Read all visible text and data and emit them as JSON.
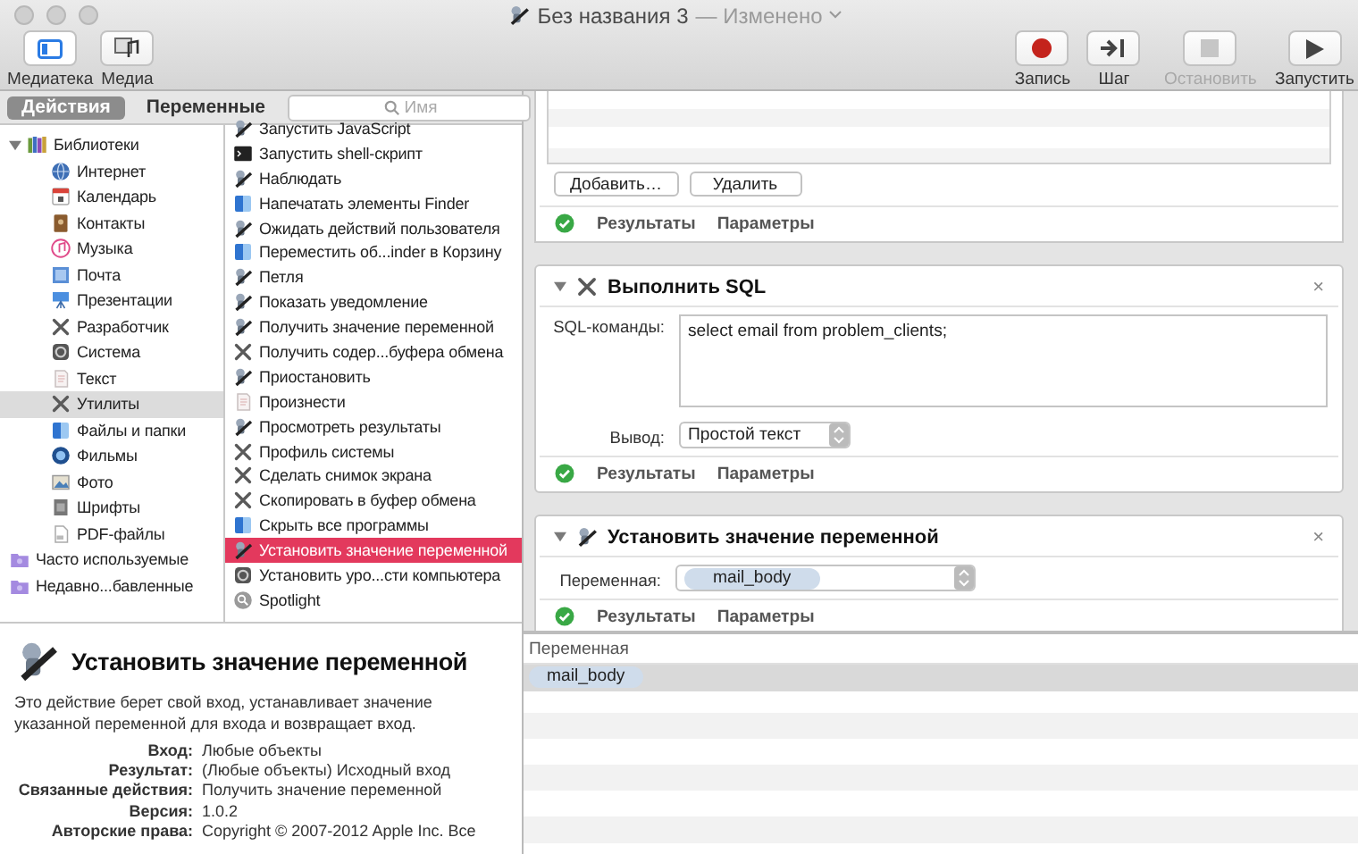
{
  "window": {
    "title": "Без названия 3",
    "subtitle": "— Изменено"
  },
  "toolbar_left": [
    {
      "label": "Медиатека",
      "kind": "library",
      "selected": true
    },
    {
      "label": "Медиа",
      "kind": "media",
      "selected": false
    }
  ],
  "toolbar_right": [
    {
      "label": "Запись",
      "kind": "record",
      "disabled": false
    },
    {
      "label": "Шаг",
      "kind": "step",
      "disabled": false
    },
    {
      "label": "Остановить",
      "kind": "stop",
      "disabled": true
    },
    {
      "label": "Запустить",
      "kind": "run",
      "disabled": false
    }
  ],
  "tabs": [
    {
      "label": "Действия",
      "selected": true
    },
    {
      "label": "Переменные",
      "selected": false
    }
  ],
  "search": {
    "placeholder": "Имя"
  },
  "library": [
    {
      "label": "Библиотеки",
      "kind": "books",
      "selected": false,
      "expanded": true,
      "children": [
        {
          "label": "Интернет",
          "kind": "globe",
          "selected": false
        },
        {
          "label": "Календарь",
          "kind": "calendar",
          "selected": false
        },
        {
          "label": "Контакты",
          "kind": "contacts",
          "selected": false
        },
        {
          "label": "Музыка",
          "kind": "music",
          "selected": false
        },
        {
          "label": "Почта",
          "kind": "mail",
          "selected": false
        },
        {
          "label": "Презентации",
          "kind": "presentation",
          "selected": false
        },
        {
          "label": "Разработчик",
          "kind": "tools",
          "selected": false
        },
        {
          "label": "Система",
          "kind": "system",
          "selected": false
        },
        {
          "label": "Текст",
          "kind": "text",
          "selected": false
        },
        {
          "label": "Утилиты",
          "kind": "tools",
          "selected": true
        },
        {
          "label": "Файлы и папки",
          "kind": "finder",
          "selected": false
        },
        {
          "label": "Фильмы",
          "kind": "movies",
          "selected": false
        },
        {
          "label": "Фото",
          "kind": "photo",
          "selected": false
        },
        {
          "label": "Шрифты",
          "kind": "fonts",
          "selected": false
        },
        {
          "label": "PDF-файлы",
          "kind": "pdf",
          "selected": false
        }
      ]
    },
    {
      "label": "Часто используемые",
      "kind": "folder",
      "selected": false
    },
    {
      "label": "Недавно...бавленные",
      "kind": "folder",
      "selected": false
    }
  ],
  "actions": [
    {
      "label": "Запустить JavaScript",
      "kind": "robot",
      "selected": false
    },
    {
      "label": "Запустить shell-скрипт",
      "kind": "terminal",
      "selected": false
    },
    {
      "label": "Наблюдать",
      "kind": "robot",
      "selected": false
    },
    {
      "label": "Напечатать элементы Finder",
      "kind": "finder",
      "selected": false
    },
    {
      "label": "Ожидать действий пользователя",
      "kind": "robot",
      "selected": false
    },
    {
      "label": "Переместить об...inder в Корзину",
      "kind": "finder",
      "selected": false
    },
    {
      "label": "Петля",
      "kind": "robot",
      "selected": false
    },
    {
      "label": "Показать уведомление",
      "kind": "robot",
      "selected": false
    },
    {
      "label": "Получить значение переменной",
      "kind": "robot",
      "selected": false
    },
    {
      "label": "Получить содер...буфера обмена",
      "kind": "tools",
      "selected": false
    },
    {
      "label": "Приостановить",
      "kind": "robot",
      "selected": false
    },
    {
      "label": "Произнести",
      "kind": "text",
      "selected": false
    },
    {
      "label": "Просмотреть результаты",
      "kind": "robot",
      "selected": false
    },
    {
      "label": "Профиль системы",
      "kind": "tools",
      "selected": false
    },
    {
      "label": "Сделать снимок экрана",
      "kind": "tools",
      "selected": false
    },
    {
      "label": "Скопировать в буфер обмена",
      "kind": "tools",
      "selected": false
    },
    {
      "label": "Скрыть все программы",
      "kind": "finder",
      "selected": false
    },
    {
      "label": "Установить значение переменной",
      "kind": "robot",
      "selected": true
    },
    {
      "label": "Установить уро...сти компьютера",
      "kind": "system",
      "selected": false
    },
    {
      "label": "Spotlight",
      "kind": "spotlight",
      "selected": false
    }
  ],
  "description": {
    "title": "Установить значение переменной",
    "text": "Это действие берет свой вход, устанавливает значение указанной переменной для входа и возвращает вход.",
    "details": [
      {
        "label": "Вход:",
        "value": "Любые объекты"
      },
      {
        "label": "Результат:",
        "value": "(Любые объекты) Исходный вход"
      },
      {
        "label": "Связанные действия:",
        "value": "Получить значение переменной"
      },
      {
        "label": "Версия:",
        "value": "1.0.2"
      },
      {
        "label": "Авторские права:",
        "value": "Copyright © 2007-2012 Apple Inc. Все"
      }
    ]
  },
  "workflow": {
    "partial_card": {
      "buttons": [
        "Добавить…",
        "Удалить"
      ],
      "footer": [
        "Результаты",
        "Параметры"
      ]
    },
    "cards": [
      {
        "kind": "sql",
        "title": "Выполнить SQL",
        "expanded": true,
        "close": "×",
        "fields": [
          {
            "kind": "textarea",
            "label": "SQL-команды:",
            "value": "select email from problem_clients;"
          },
          {
            "kind": "popup",
            "label": "Вывод:",
            "value": "Простой текст"
          }
        ],
        "footer": [
          "Результаты",
          "Параметры"
        ]
      },
      {
        "kind": "variable",
        "title": "Установить значение переменной",
        "expanded": true,
        "close": "×",
        "fields": [
          {
            "kind": "token_popup",
            "label": "Переменная:",
            "value": "mail_body"
          }
        ],
        "footer": [
          "Результаты",
          "Параметры"
        ]
      }
    ]
  },
  "variables": {
    "column": "Переменная",
    "rows": [
      {
        "name": "mail_body",
        "selected": true
      }
    ]
  }
}
